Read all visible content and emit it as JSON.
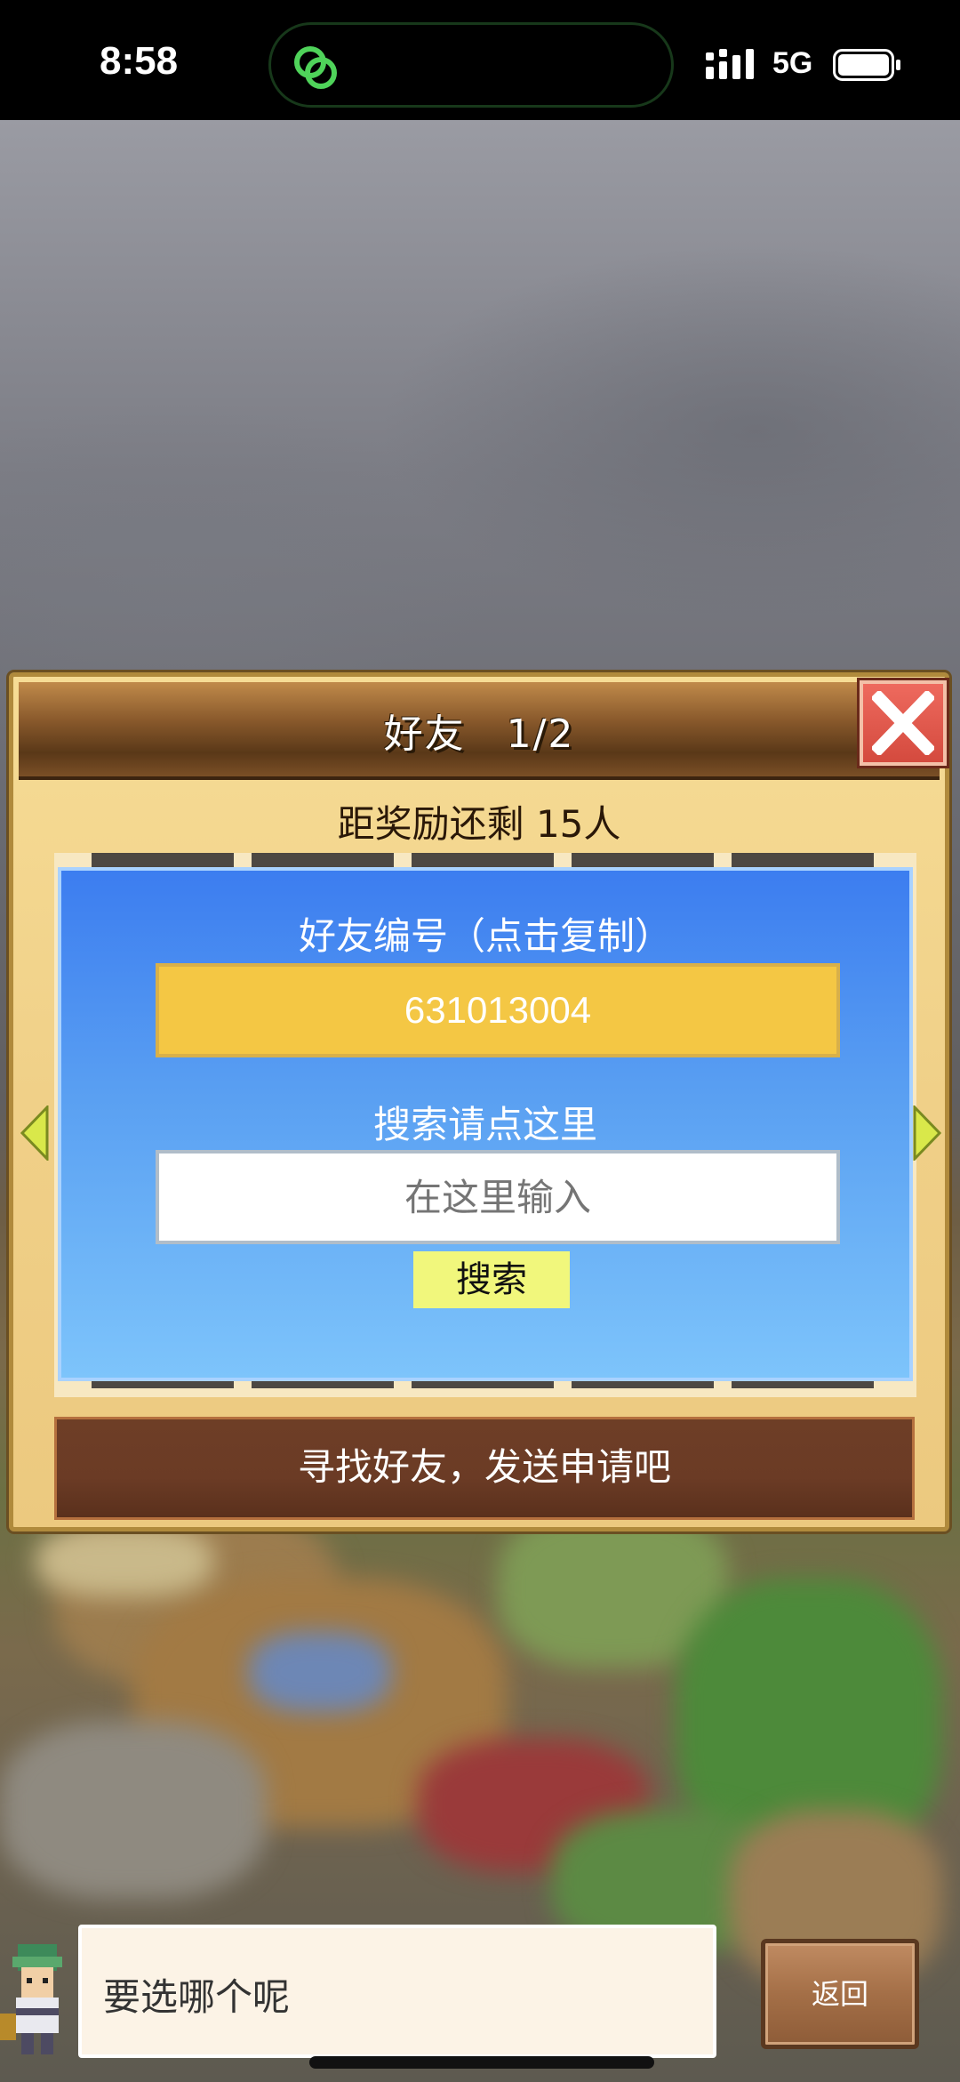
{
  "status_bar": {
    "time": "8:58",
    "network": "5G",
    "icons": [
      "chat-bubble-icon",
      "signal-icon",
      "battery-icon"
    ]
  },
  "dialog": {
    "title": "好友　1/2",
    "close_icon": "close-icon",
    "subtitle": "距奖励还剩 15人",
    "id_label": "好友编号（点击复制）",
    "id_value": "631013004",
    "search_label": "搜索请点这里",
    "search_placeholder": "在这里输入",
    "search_button": "搜索",
    "bottom_button": "寻找好友，发送申请吧"
  },
  "chat": {
    "message": "要选哪个呢",
    "back_button": "返回"
  },
  "colors": {
    "panel_blue": "#3c7df0",
    "id_yellow": "#f4c744",
    "search_button": "#f1f77c",
    "close_red": "#d44a3e",
    "bottom_bar": "#6b3b25"
  }
}
